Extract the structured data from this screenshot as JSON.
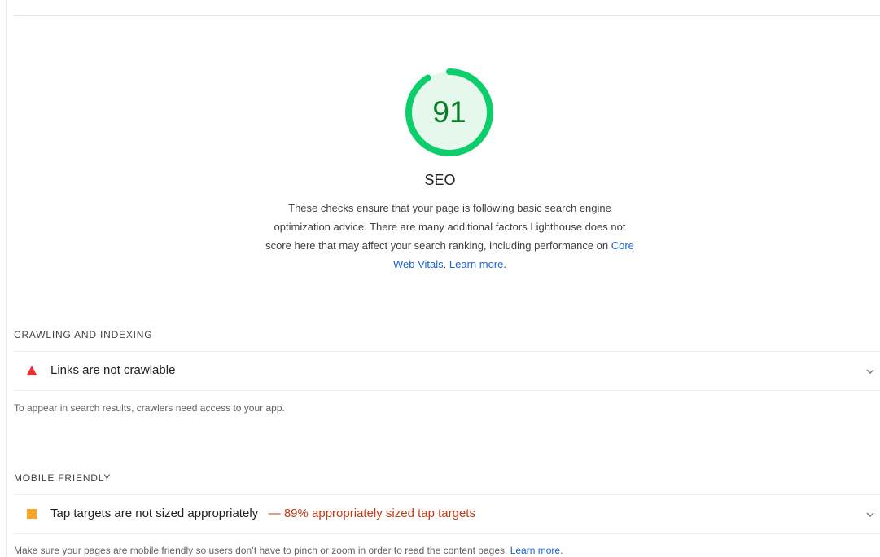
{
  "score": {
    "value": "91",
    "fraction": 0.91,
    "title": "SEO",
    "description_text": "These checks ensure that your page is following basic search engine optimization advice. There are many additional factors Lighthouse does not score here that may affect your search ranking, including performance on ",
    "core_web_vitals_link": "Core Web Vitals",
    "separator": ". ",
    "learn_more_link": "Learn more",
    "end_punct": ".",
    "colors": {
      "pass_ring": "#0cce6b",
      "pass_fill": "#e6f7ec",
      "pass_text": "#0c7e2a"
    }
  },
  "groups": [
    {
      "title": "CRAWLING AND INDEXING",
      "audit": {
        "icon": "fail-triangle-icon",
        "icon_color": "#eb2f2f",
        "title": "Links are not crawlable",
        "display_value": ""
      },
      "description": "To appear in search results, crawlers need access to your app.",
      "learn_more": ""
    },
    {
      "title": "MOBILE FRIENDLY",
      "audit": {
        "icon": "average-square-icon",
        "icon_color": "#f6a623",
        "title": "Tap targets are not sized appropriately",
        "display_value": "— 89% appropriately sized tap targets"
      },
      "description": "Make sure your pages are mobile friendly so users don’t have to pinch or zoom in order to read the content pages. ",
      "learn_more": "Learn more",
      "end_punct": "."
    }
  ]
}
